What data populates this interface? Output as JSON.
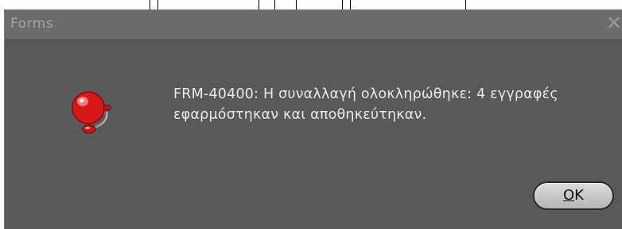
{
  "window": {
    "title": "Forms",
    "close_glyph": "✕"
  },
  "dialog": {
    "message_line1": "FRM-40400: Η συναλλαγή ολοκληρώθηκε: 4 εγγραφές",
    "message_line2": "εφαρμόστηκαν και αποθηκεύτηκαν.",
    "icon": "alarm-bell-icon",
    "ok_button": {
      "mnemonic": "O",
      "rest": "K"
    }
  },
  "colors": {
    "dialog_bg": "#595959",
    "titlebar_bg": "#6c6c6c",
    "bell_red": "#e11b1b",
    "button_bg": "#cfcfcf"
  }
}
